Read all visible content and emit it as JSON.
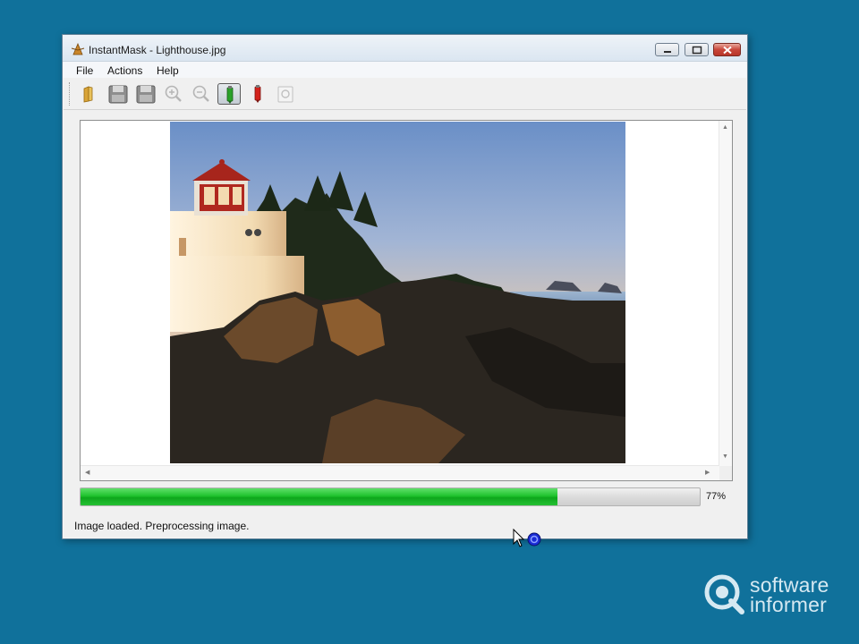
{
  "window": {
    "title": "InstantMask - Lighthouse.jpg",
    "controls": {
      "minimize": "minimize-icon",
      "maximize": "maximize-icon",
      "close": "close-icon"
    }
  },
  "menu": {
    "items": [
      {
        "label": "File"
      },
      {
        "label": "Actions"
      },
      {
        "label": "Help"
      }
    ]
  },
  "toolbar": {
    "tools": [
      {
        "name": "open-folder",
        "icon": "folder-icon"
      },
      {
        "name": "save",
        "icon": "floppy-disk-icon"
      },
      {
        "name": "save-as",
        "icon": "floppy-disk-icon"
      },
      {
        "name": "zoom-in",
        "icon": "zoom-in-icon"
      },
      {
        "name": "zoom-out",
        "icon": "zoom-out-icon"
      },
      {
        "name": "green-marker",
        "icon": "green-marker-icon",
        "active": true
      },
      {
        "name": "red-marker",
        "icon": "red-marker-icon"
      },
      {
        "name": "preview",
        "icon": "preview-icon"
      }
    ]
  },
  "progress": {
    "value": 0.77,
    "label": "77%",
    "fill_color": "#1fc22d"
  },
  "status": {
    "text": "Image loaded. Preprocessing image."
  },
  "colors": {
    "desktop": "#10719b",
    "window_bg": "#f0f0f0"
  },
  "watermark": {
    "line1": "software",
    "line2": "informer"
  }
}
